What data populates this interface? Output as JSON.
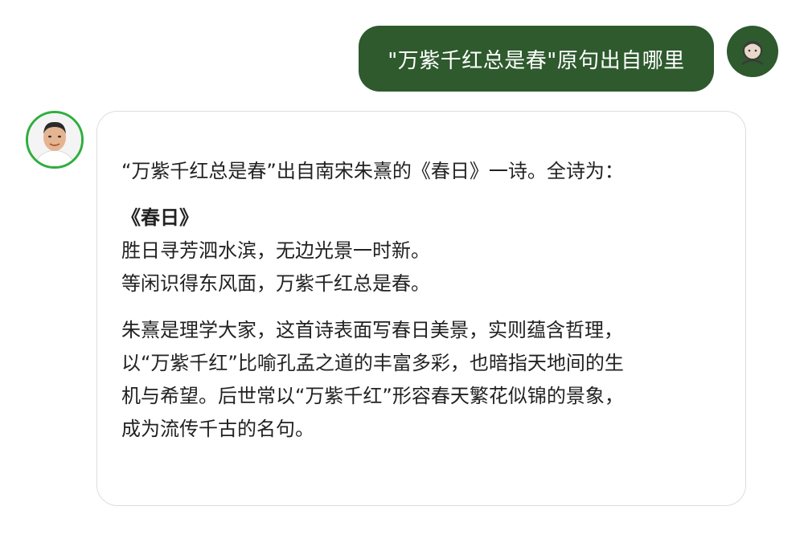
{
  "user_message": {
    "text": "\"万紫千红总是春\"原句出自哪里",
    "avatar_icon": "user-silhouette-icon"
  },
  "bot_message": {
    "avatar_icon": "assistant-portrait-icon",
    "intro": "“万紫千红总是春”出自南宋朱熹的《春日》一诗。全诗为：",
    "poem_title": "《春日》",
    "poem_lines": [
      "胜日寻芳泗水滨，无边光景一时新。",
      "等闲识得东风面，万紫千红总是春。"
    ],
    "explanation_lines": [
      "朱熹是理学大家，这首诗表面写春日美景，实则蕴含哲理，",
      "以“万紫千红”比喻孔孟之道的丰富多彩，也暗指天地间的生",
      "机与希望。后世常以“万紫千红”形容春天繁花似锦的景象，",
      "成为流传千古的名句。"
    ]
  },
  "colors": {
    "user_bubble": "#2e5a2e",
    "avatar_ring": "#2fae3f",
    "bot_border": "#dddddd"
  }
}
